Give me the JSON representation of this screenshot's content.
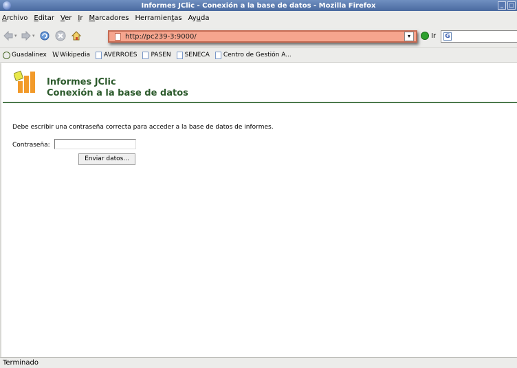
{
  "window": {
    "title": "Informes JClic - Conexión a la base de datos - Mozilla Firefox"
  },
  "menu": {
    "items": [
      {
        "label": "Archivo",
        "mnemonic": "A",
        "rest": "rchivo"
      },
      {
        "label": "Editar",
        "mnemonic": "E",
        "rest": "ditar"
      },
      {
        "label": "Ver",
        "mnemonic": "V",
        "rest": "er"
      },
      {
        "label": "Ir",
        "mnemonic": "I",
        "rest": "r"
      },
      {
        "label": "Marcadores",
        "mnemonic": "M",
        "rest": "arcadores"
      },
      {
        "label": "Herramientas",
        "pre": "Herramien",
        "mnemonic": "t",
        "rest": "as"
      },
      {
        "label": "Ayuda",
        "pre": "Ay",
        "mnemonic": "u",
        "rest": "da"
      }
    ]
  },
  "toolbar": {
    "url": "http://pc239-3:9000/",
    "go_label": "Ir",
    "search_icon": "G"
  },
  "bookmarks": [
    {
      "label": "Guadalinex",
      "icon": "guadalinex-icon"
    },
    {
      "label": "Wikipedia",
      "icon": "wikipedia-icon",
      "prefix": "W"
    },
    {
      "label": "AVERROES",
      "icon": "page-icon"
    },
    {
      "label": "PASEN",
      "icon": "page-icon"
    },
    {
      "label": "SENECA",
      "icon": "page-icon"
    },
    {
      "label": "Centro de Gestión A...",
      "icon": "page-icon"
    }
  ],
  "page": {
    "header_line1": "Informes JClic",
    "header_line2": "Conexión a la base de datos",
    "message": "Debe escribir una contraseña correcta para acceder a la base de datos de informes.",
    "password_label": "Contraseña:",
    "password_value": "",
    "submit_label": "Enviar datos..."
  },
  "status": {
    "text": "Terminado"
  },
  "colors": {
    "header_green": "#2c5a2c",
    "url_highlight": "#f6a58e",
    "titlebar": "#5878b0"
  }
}
